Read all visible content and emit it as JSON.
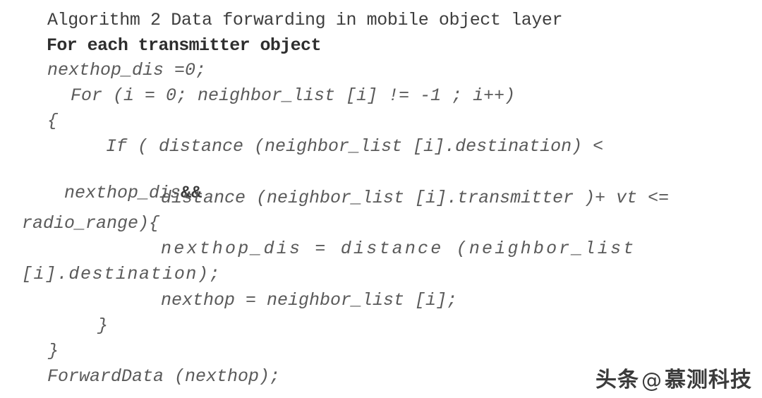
{
  "document": {
    "type": "algorithm-pseudocode-figure",
    "background_color": "#ffffff",
    "text_color": "#4a4a4a"
  },
  "algorithm": {
    "header": "Algorithm 2 Data forwarding in mobile object layer",
    "subheader": "For each transmitter object",
    "lines": [
      {
        "id": "line-1",
        "text": "nexthop_dis =0;"
      },
      {
        "id": "line-2",
        "text": "For (i = 0; neighbor_list [i] != -1 ; i++)"
      },
      {
        "id": "line-3",
        "text": "{"
      },
      {
        "id": "line-4",
        "text": "If ( distance (neighbor_list [i].destination) <"
      },
      {
        "id": "line-5a",
        "text": "nexthop_dis"
      },
      {
        "id": "line-5b",
        "text": "&&"
      },
      {
        "id": "line-6",
        "text": "distance (neighbor_list [i].transmitter )+ vt <="
      },
      {
        "id": "line-7",
        "text": "radio_range){"
      },
      {
        "id": "line-8",
        "text": "nexthop_dis = distance (neighbor_list"
      },
      {
        "id": "line-9",
        "text": "[i].destination);"
      },
      {
        "id": "line-10",
        "text": "nexthop = neighbor_list [i];"
      },
      {
        "id": "line-11",
        "text": "}"
      },
      {
        "id": "line-12",
        "text": "}"
      },
      {
        "id": "line-13",
        "text": "ForwardData (nexthop);"
      }
    ]
  },
  "watermark": {
    "brand": "头条",
    "at": "@",
    "account": "慕测科技"
  }
}
